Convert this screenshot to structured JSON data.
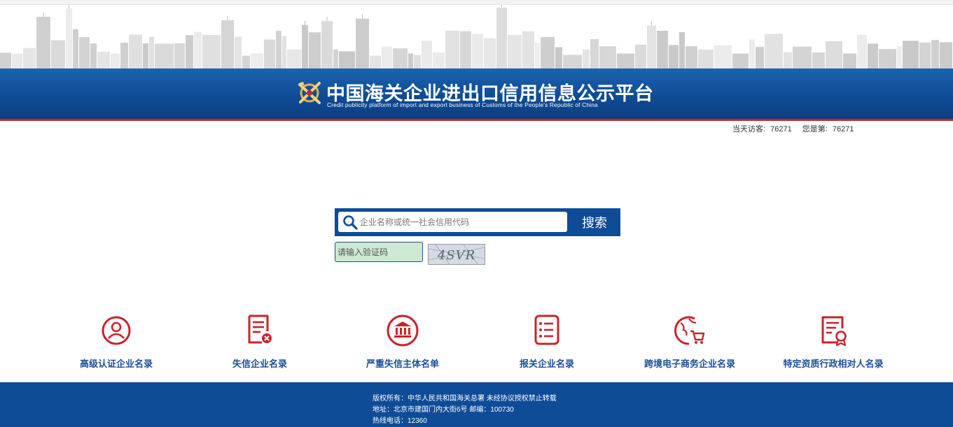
{
  "header": {
    "title": "中国海关企业进出口信用信息公示平台",
    "subtitle": "Credit publicity platform of import and export business of Customs of the People's Republic of China"
  },
  "visitor": {
    "today_label": "当天访客:",
    "today_count": "76271",
    "you_label": "您是第:",
    "you_count": "76271"
  },
  "search": {
    "placeholder": "企业名称或统一社会信用代码",
    "value": "",
    "button_label": "搜索"
  },
  "captcha": {
    "placeholder": "请输入验证码",
    "image_text": "4SVR"
  },
  "categories": [
    {
      "label": "高级认证企业名录",
      "icon": "user-circle-icon"
    },
    {
      "label": "失信企业名录",
      "icon": "document-x-icon"
    },
    {
      "label": "严重失信主体名单",
      "icon": "bank-building-icon"
    },
    {
      "label": "报关企业名录",
      "icon": "list-document-icon"
    },
    {
      "label": "跨境电子商务企业名录",
      "icon": "globe-cart-icon"
    },
    {
      "label": "特定资质行政相对人名录",
      "icon": "certificate-icon"
    }
  ],
  "footer": {
    "copyright": "版权所有：中华人民共和国海关总署   未经协议授权禁止转载",
    "address": "地址：北京市建国门内大街6号  邮编：100730",
    "hotline": "热线电话：12360"
  },
  "colors": {
    "brand_blue": "#0e4c97",
    "accent_red": "#c8242b",
    "label_blue": "#1b4f96",
    "captcha_bg": "#cde8d3"
  }
}
